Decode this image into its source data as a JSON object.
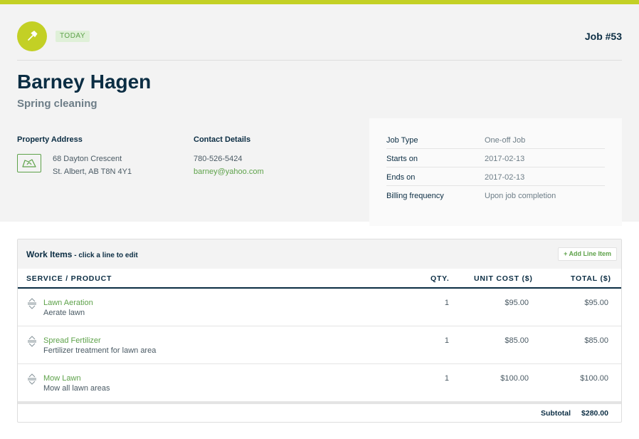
{
  "colors": {
    "accent": "#c3d025",
    "link": "#5ea24a",
    "heading": "#0b2d43"
  },
  "header": {
    "badge": "TODAY",
    "job_number": "Job #53",
    "client_name": "Barney Hagen",
    "job_title": "Spring cleaning",
    "avatar_icon": "hammer-icon"
  },
  "property": {
    "heading": "Property Address",
    "icon": "map-icon",
    "line1": "68 Dayton Crescent",
    "line2": "St. Albert, AB T8N 4Y1"
  },
  "contact": {
    "heading": "Contact Details",
    "phone": "780-526-5424",
    "email": "barney@yahoo.com"
  },
  "details": [
    {
      "label": "Job Type",
      "value": "One-off Job"
    },
    {
      "label": "Starts on",
      "value": "2017-02-13"
    },
    {
      "label": "Ends on",
      "value": "2017-02-13"
    },
    {
      "label": "Billing frequency",
      "value": "Upon job completion"
    }
  ],
  "work_items": {
    "title": "Work Items",
    "hint": " - click a line to edit",
    "add_button": "+ Add Line Item",
    "columns": {
      "service": "SERVICE / PRODUCT",
      "qty": "QTY.",
      "unit_cost": "UNIT COST ($)",
      "total": "TOTAL ($)"
    },
    "rows": [
      {
        "name": "Lawn Aeration",
        "description": "Aerate lawn",
        "qty": "1",
        "unit_cost": "$95.00",
        "total": "$95.00"
      },
      {
        "name": "Spread Fertilizer",
        "description": "Fertilizer treatment for lawn area",
        "qty": "1",
        "unit_cost": "$85.00",
        "total": "$85.00"
      },
      {
        "name": "Mow Lawn",
        "description": "Mow all lawn areas",
        "qty": "1",
        "unit_cost": "$100.00",
        "total": "$100.00"
      }
    ],
    "subtotal_label": "Subtotal",
    "subtotal_value": "$280.00"
  }
}
